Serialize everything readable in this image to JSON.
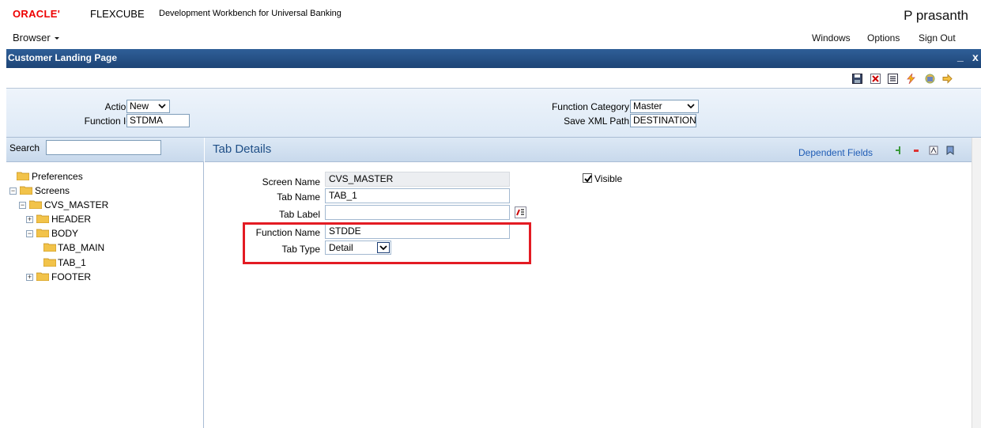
{
  "header": {
    "brand_oracle": "ORACLE'",
    "brand_product": "FLEXCUBE",
    "app_subtitle": "Development Workbench for Universal Banking",
    "user_name": "P prasanth",
    "browser_menu": "Browser",
    "nav": [
      "Windows",
      "Options",
      "Sign Out"
    ]
  },
  "window": {
    "title": "Customer Landing Page",
    "minimize": "_",
    "close": "x"
  },
  "toolbar": {
    "icons": [
      "save-icon",
      "delete-icon",
      "list-icon",
      "lightning-icon",
      "package-icon",
      "exit-arrow-icon"
    ]
  },
  "form": {
    "action_label": "Action",
    "action_value": "New",
    "function_id_label": "Function Id",
    "function_id_value": "STDMA",
    "function_category_label": "Function Category",
    "function_category_value": "Master",
    "save_xml_path_label": "Save XML Path",
    "save_xml_path_value": "DESTINATION"
  },
  "left": {
    "search_label": "Search",
    "search_value": "",
    "tree": [
      {
        "label": "Preferences"
      },
      {
        "label": "Screens"
      },
      {
        "label": "CVS_MASTER"
      },
      {
        "label": "HEADER"
      },
      {
        "label": "BODY"
      },
      {
        "label": "TAB_MAIN"
      },
      {
        "label": "TAB_1"
      },
      {
        "label": "FOOTER"
      }
    ]
  },
  "tab_details": {
    "title": "Tab Details",
    "dependent_fields": "Dependent Fields",
    "screen_name_label": "Screen Name",
    "screen_name_value": "CVS_MASTER",
    "visible_label": "Visible",
    "visible_checked": true,
    "tab_name_label": "Tab Name",
    "tab_name_value": "TAB_1",
    "tab_label_label": "Tab Label",
    "tab_label_value": "",
    "function_name_label": "Function Name",
    "function_name_value": "STDDE",
    "tab_type_label": "Tab Type",
    "tab_type_value": "Detail"
  },
  "colors": {
    "brand_red": "#e00000",
    "window_bar": "#1d4476",
    "highlight_frame": "#e31b23",
    "link_blue": "#1f5cb5"
  }
}
